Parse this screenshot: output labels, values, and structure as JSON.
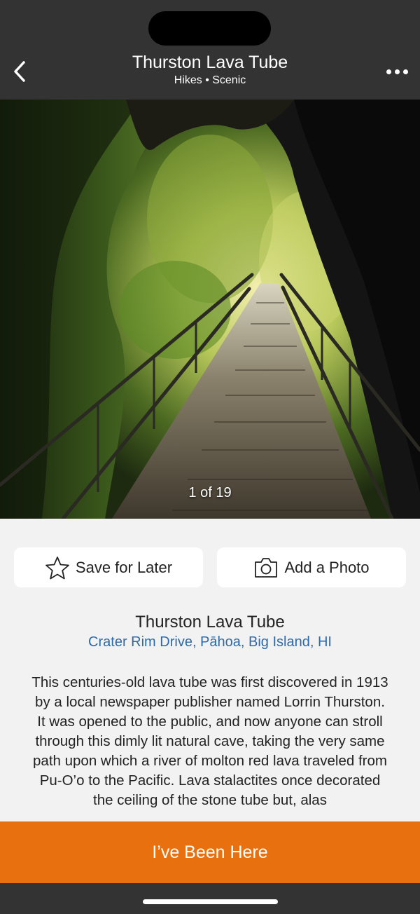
{
  "header": {
    "title": "Thurston Lava Tube",
    "subtitle": "Hikes • Scenic",
    "background": "#333333"
  },
  "photo": {
    "counter": "1 of 19"
  },
  "actions": {
    "save_label": "Save for Later",
    "add_photo_label": "Add a Photo"
  },
  "place": {
    "name": "Thurston Lava Tube",
    "address": "Crater Rim Drive, Pāhoa, Big Island, HI",
    "description": "This centuries-old lava tube was first discovered in 1913 by a local newspaper publisher named Lorrin Thurston. It was opened to the public, and now anyone can stroll through this dimly lit natural cave, taking the very same path upon which a river of molton red lava traveled from Pu-O’o to the Pacific. Lava stalactites once decorated the ceiling of the stone tube but, alas"
  },
  "cta": {
    "label": "I’ve Been Here",
    "color": "#e8700e"
  },
  "colors": {
    "link": "#2f6aa8",
    "page_background": "#f2f2f2"
  }
}
